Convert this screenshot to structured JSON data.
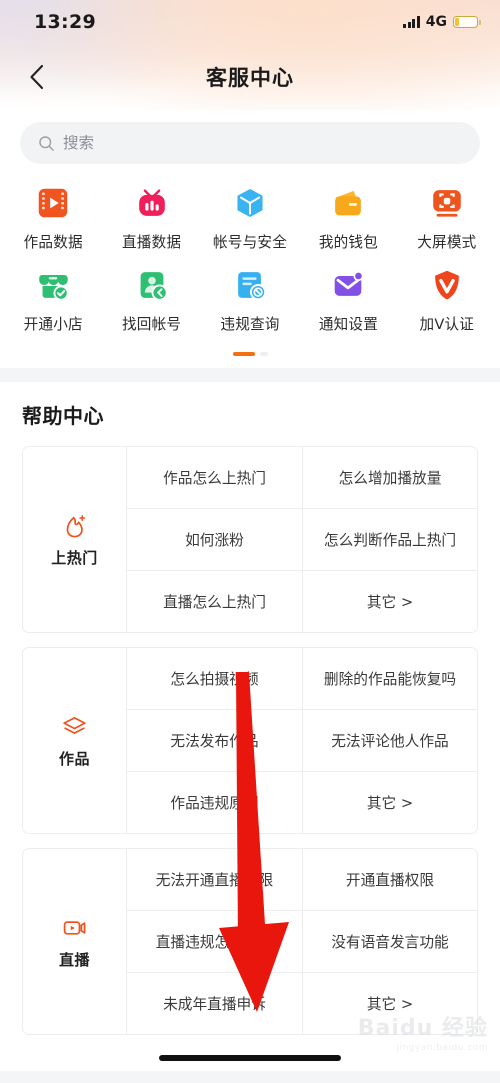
{
  "status_bar": {
    "time": "13:29",
    "network": "4G",
    "signal_icon": "signal-bars-icon",
    "battery_icon": "battery-low-icon",
    "battery_level_pct": 16
  },
  "nav": {
    "back_icon": "chevron-left-icon",
    "title": "客服中心"
  },
  "search": {
    "icon": "search-icon",
    "placeholder": "搜索",
    "value": ""
  },
  "shortcuts": {
    "rows": [
      [
        {
          "label": "作品数据",
          "icon": "video-film-icon",
          "color": "#f05a20"
        },
        {
          "label": "直播数据",
          "icon": "tv-chart-icon",
          "color": "#ef1f5b"
        },
        {
          "label": "帐号与安全",
          "icon": "cube-icon",
          "color": "#39b4f0"
        },
        {
          "label": "我的钱包",
          "icon": "wallet-icon",
          "color": "#f7a81b"
        },
        {
          "label": "大屏模式",
          "icon": "big-screen-icon",
          "color": "#f0541e"
        }
      ],
      [
        {
          "label": "开通小店",
          "icon": "shop-check-icon",
          "color": "#2fbf72"
        },
        {
          "label": "找回帐号",
          "icon": "account-recover-icon",
          "color": "#2fbf72"
        },
        {
          "label": "违规查询",
          "icon": "doc-ban-icon",
          "color": "#37b0f0"
        },
        {
          "label": "通知设置",
          "icon": "mail-bell-icon",
          "color": "#8250e6"
        },
        {
          "label": "加V认证",
          "icon": "shield-v-icon",
          "color": "#f04a1e"
        }
      ]
    ],
    "pagination": {
      "total": 2,
      "active_index": 0,
      "active_color": "#f2700f"
    }
  },
  "help": {
    "title": "帮助中心",
    "cards": [
      {
        "category": "上热门",
        "icon": "flame-plus-icon",
        "icon_color": "#f0531f",
        "questions": [
          [
            "作品怎么上热门",
            "怎么增加播放量"
          ],
          [
            "如何涨粉",
            "怎么判断作品上热门"
          ],
          [
            "直播怎么上热门",
            "其它 >"
          ]
        ]
      },
      {
        "category": "作品",
        "icon": "layers-icon",
        "icon_color": "#f0531f",
        "questions": [
          [
            "怎么拍摄视频",
            "删除的作品能恢复吗"
          ],
          [
            "无法发布作品",
            "无法评论他人作品"
          ],
          [
            "作品违规原因",
            "其它 >"
          ]
        ]
      },
      {
        "category": "直播",
        "icon": "live-video-icon",
        "icon_color": "#f0531f",
        "questions": [
          [
            "无法开通直播权限",
            "开通直播权限"
          ],
          [
            "直播违规怎么申诉",
            "没有语音发言功能"
          ],
          [
            "未成年直播申诉",
            "其它 >"
          ]
        ]
      }
    ]
  },
  "annotation": {
    "arrow_icon": "red-down-arrow-annotation",
    "color": "#e8160c"
  },
  "watermark": {
    "main": "Baidu 经验",
    "sub": "jingyan.baidu.com"
  }
}
